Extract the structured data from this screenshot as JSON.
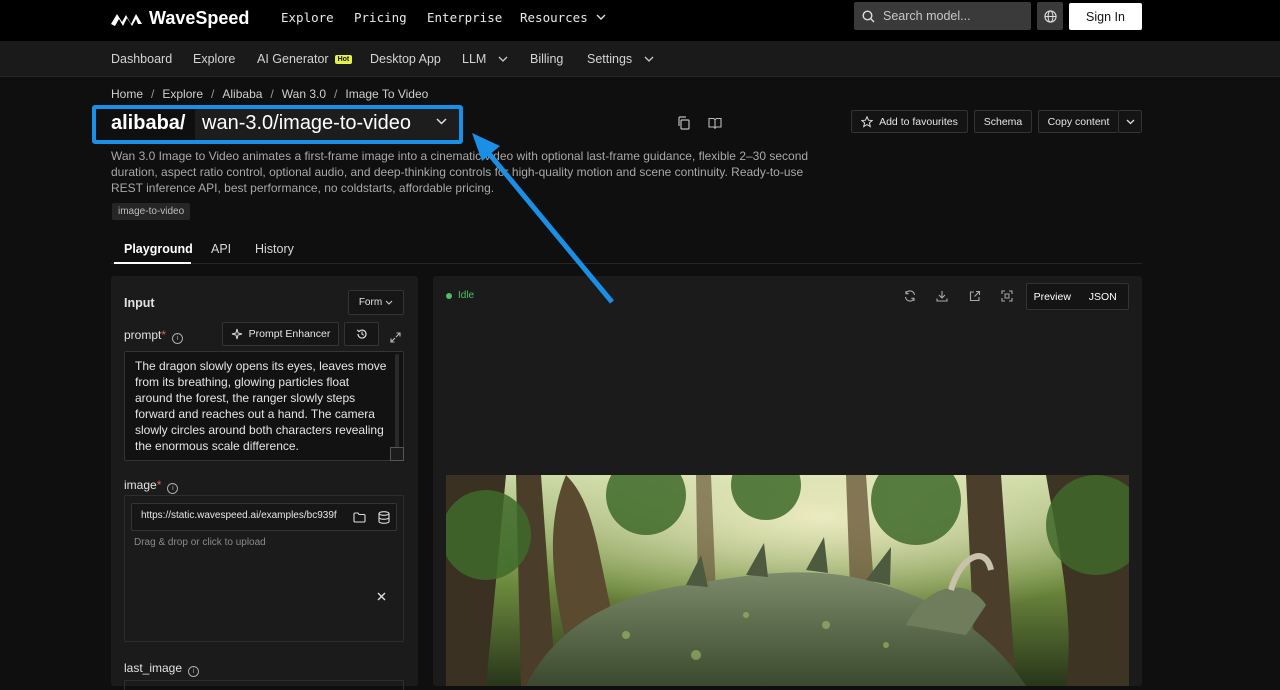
{
  "brand": {
    "name": "WaveSpeed"
  },
  "topnav": {
    "explore": "Explore",
    "pricing": "Pricing",
    "enterprise": "Enterprise",
    "resources": "Resources"
  },
  "search": {
    "placeholder": "Search model..."
  },
  "signin": "Sign In",
  "subnav": {
    "dashboard": "Dashboard",
    "explore": "Explore",
    "ai_generator": "AI Generator",
    "hot": "Hot",
    "desktop": "Desktop App",
    "llm": "LLM",
    "billing": "Billing",
    "settings": "Settings"
  },
  "breadcrumb": [
    "Home",
    "Explore",
    "Alibaba",
    "Wan 3.0",
    "Image To Video"
  ],
  "title": {
    "owner": "alibaba/",
    "model": "wan-3.0/image-to-video"
  },
  "actions": {
    "favourite": "Add to favourites",
    "schema": "Schema",
    "copy": "Copy content"
  },
  "description": "Wan 3.0 Image to Video animates a first-frame image into a cinematic video with optional last-frame guidance, flexible 2–30 second duration, aspect ratio control, optional audio, and deep-thinking controls for high-quality motion and scene continuity. Ready-to-use REST inference API, best performance, no coldstarts, affordable pricing.",
  "tag": "image-to-video",
  "tabs": {
    "playground": "Playground",
    "api": "API",
    "history": "History"
  },
  "input": {
    "heading": "Input",
    "mode": "Form",
    "prompt_label": "prompt",
    "required_mark": "*",
    "prompt_enhancer": "Prompt Enhancer",
    "prompt_value": "The dragon slowly opens its eyes, leaves move from its breathing, glowing particles float around the forest, the ranger slowly steps forward and reaches out a hand. The camera slowly circles around both characters revealing the enormous scale difference.",
    "image_label": "image",
    "image_url": "https://static.wavespeed.ai/examples/bc939f",
    "drag_hint": "Drag & drop or click to upload",
    "last_image_label": "last_image"
  },
  "output": {
    "status": "Idle",
    "preview": "Preview",
    "json": "JSON"
  },
  "colors": {
    "accent": "#1a8fe6",
    "status_idle": "#4fc05f",
    "hot": "#e3f04a"
  }
}
